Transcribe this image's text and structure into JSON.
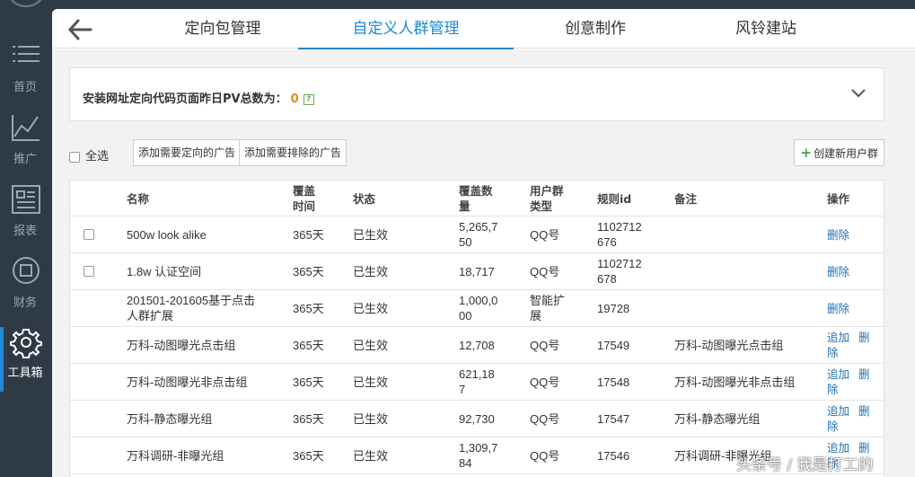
{
  "sidebar": {
    "items": [
      {
        "label": "首页",
        "icon": "list-icon"
      },
      {
        "label": "推广",
        "icon": "chart-line-icon"
      },
      {
        "label": "报表",
        "icon": "report-icon"
      },
      {
        "label": "财务",
        "icon": "finance-icon"
      },
      {
        "label": "工具箱",
        "icon": "gear-icon",
        "active": true
      }
    ]
  },
  "tabs": [
    {
      "label": "定向包管理"
    },
    {
      "label": "自定义人群管理",
      "active": true
    },
    {
      "label": "创意制作"
    },
    {
      "label": "风铃建站"
    }
  ],
  "info": {
    "text": "安装网址定向代码页面昨日PV总数为：",
    "value": "0",
    "help": "?"
  },
  "toolbar": {
    "select_all": "全选",
    "btn_include": "添加需要定向的广告",
    "btn_exclude": "添加需要排除的广告",
    "btn_create": "创建新用户群"
  },
  "table": {
    "headers": {
      "name": "名称",
      "time": "覆盖\n时间",
      "status": "状态",
      "coverage": "覆盖数\n量",
      "type": "用户群\n类型",
      "rule_id": "规则id",
      "note": "备注",
      "ops": "操作"
    },
    "rows": [
      {
        "check": true,
        "name": "500w look alike",
        "time": "365天",
        "status": "已生效",
        "coverage": "5,265,7\n50",
        "type": "QQ号",
        "rule_id": "1102712\n676",
        "note": "",
        "append": "",
        "delete": "删除"
      },
      {
        "check": true,
        "name": "1.8w 认证空间",
        "time": "365天",
        "status": "已生效",
        "coverage": "18,717",
        "type": "QQ号",
        "rule_id": "1102712\n678",
        "note": "",
        "append": "",
        "delete": "删除"
      },
      {
        "check": false,
        "name": "201501-201605基于点击\n人群扩展",
        "time": "365天",
        "status": "已生效",
        "coverage": "1,000,0\n00",
        "type": "智能扩\n展",
        "rule_id": "19728",
        "note": "",
        "append": "",
        "delete": "删除"
      },
      {
        "check": false,
        "name": "万科-动图曝光点击组",
        "time": "365天",
        "status": "已生效",
        "coverage": "12,708",
        "type": "QQ号",
        "rule_id": "17549",
        "note": "万科-动图曝光点击组",
        "append": "追加",
        "delete": "删\n除"
      },
      {
        "check": false,
        "name": "万科-动图曝光非点击组",
        "time": "365天",
        "status": "已生效",
        "coverage": "621,18\n7",
        "type": "QQ号",
        "rule_id": "17548",
        "note": "万科-动图曝光非点击组",
        "append": "追加",
        "delete": "删\n除"
      },
      {
        "check": false,
        "name": "万科-静态曝光组",
        "time": "365天",
        "status": "已生效",
        "coverage": "92,730",
        "type": "QQ号",
        "rule_id": "17547",
        "note": "万科-静态曝光组",
        "append": "追加",
        "delete": "删\n除"
      },
      {
        "check": false,
        "name": "万科调研-非曝光组",
        "time": "365天",
        "status": "已生效",
        "coverage": "1,309,7\n84",
        "type": "QQ号",
        "rule_id": "17546",
        "note": "万科调研-非曝光组",
        "append": "追加",
        "delete": "删\n除"
      }
    ]
  },
  "watermark": "头条号 / 我是打工的",
  "colors": {
    "accent": "#1f89d8",
    "sidebar": "#2f3a47",
    "value": "#e28a1a",
    "top_strip": "#3ec69e"
  }
}
